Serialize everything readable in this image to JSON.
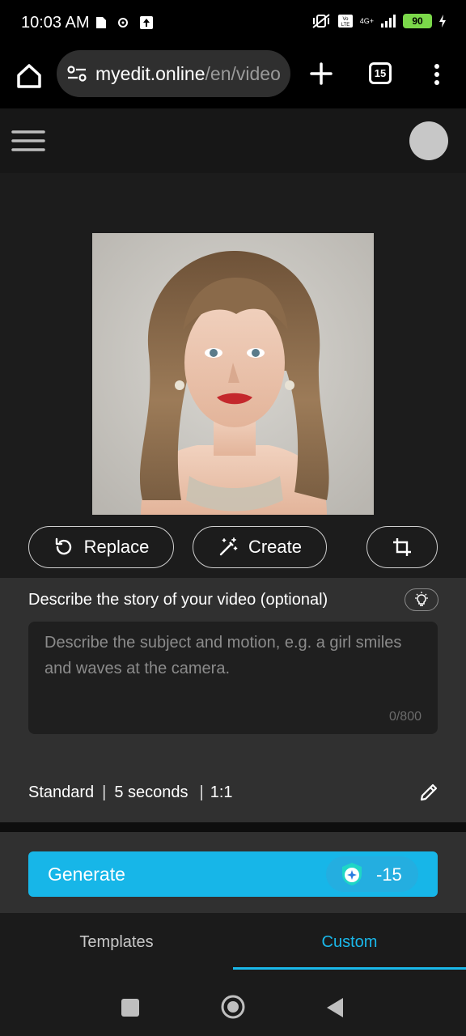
{
  "status_bar": {
    "time": "10:03 AM",
    "battery": "90",
    "network": "4G+"
  },
  "browser": {
    "url_domain": "myedit.online",
    "url_path": "/en/video",
    "tab_count": "15"
  },
  "editor": {
    "actions": {
      "replace": "Replace",
      "create": "Create"
    },
    "story": {
      "label": "Describe the story of your video (optional)",
      "placeholder": "Describe the subject and motion, e.g. a girl smiles and waves at the camera.",
      "counter": "0/800"
    },
    "settings": {
      "quality": "Standard",
      "duration": "5 seconds",
      "ratio": "1:1"
    },
    "generate": {
      "label": "Generate",
      "credits": "-15"
    }
  },
  "tabs": [
    {
      "label": "Templates",
      "active": false
    },
    {
      "label": "Custom",
      "active": true
    }
  ],
  "colors": {
    "accent": "#17b6e8",
    "panel": "#303030",
    "canvas": "#1c1c1c"
  }
}
